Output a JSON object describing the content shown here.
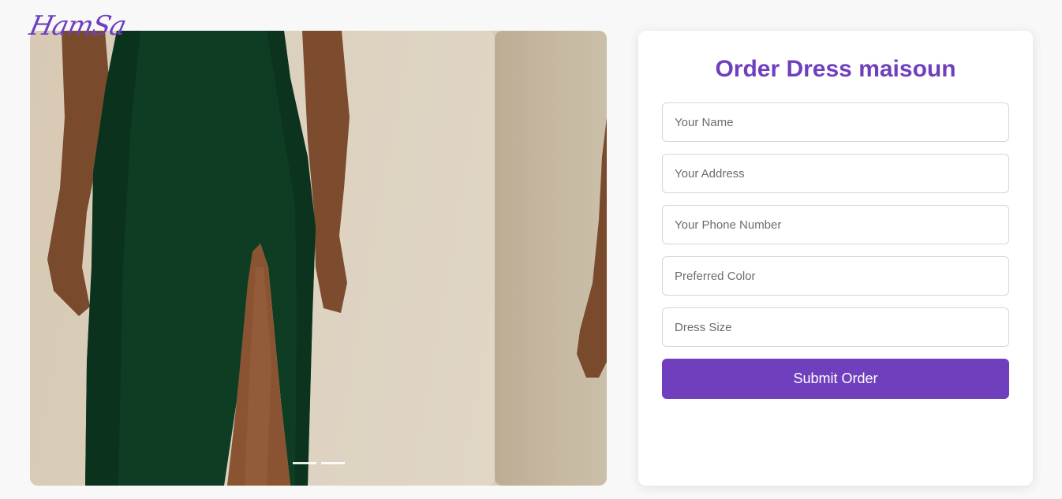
{
  "brand": {
    "logo_text": "HamSa",
    "accent_color": "#6f3fbd"
  },
  "carousel": {
    "slides": [
      {
        "label": "Green velvet dress with high slit",
        "active": true
      },
      {
        "label": "Dress side view",
        "active": false
      }
    ],
    "indicator_count": 2,
    "active_index": 0
  },
  "order_form": {
    "title": "Order Dress maisoun",
    "fields": {
      "name": {
        "placeholder": "Your Name",
        "value": ""
      },
      "address": {
        "placeholder": "Your Address",
        "value": ""
      },
      "phone": {
        "placeholder": "Your Phone Number",
        "value": ""
      },
      "color": {
        "placeholder": "Preferred Color",
        "value": ""
      },
      "size": {
        "placeholder": "Dress Size",
        "value": ""
      }
    },
    "submit_label": "Submit Order"
  }
}
